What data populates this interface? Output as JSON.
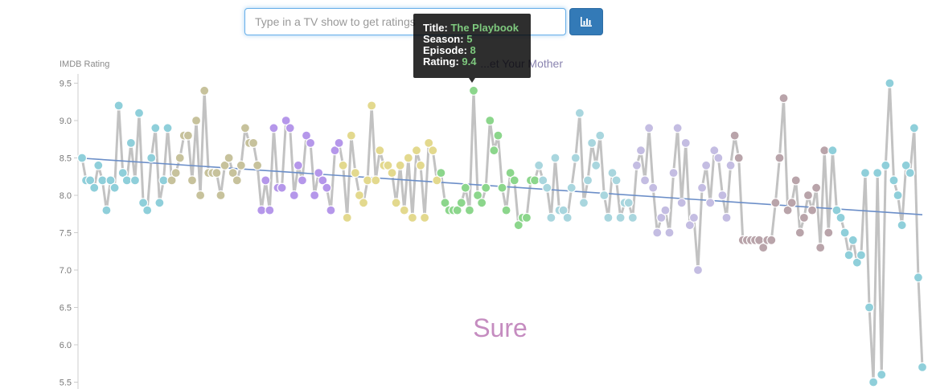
{
  "search": {
    "placeholder": "Type in a TV show to get ratings"
  },
  "tooltip": {
    "title_label": "Title:",
    "title_value": "The Playbook",
    "season_label": "Season:",
    "season_value": "5",
    "episode_label": "Episode:",
    "episode_value": "8",
    "rating_label": "Rating:",
    "rating_value": "9.4"
  },
  "colors": {
    "line": "#c2c2c2",
    "trend": "#6b8ec8",
    "overlay_text": "#c58cc0",
    "season_colors": [
      "#8fcfda",
      "#c7c29c",
      "#b597ea",
      "#e3d98e",
      "#8cd68c",
      "#a9d6de",
      "#c4bde2",
      "#b9a4aa"
    ]
  },
  "chart_data": {
    "type": "scatter",
    "title": "...et Your Mother",
    "ylabel": "IMDB Rating",
    "xlabel": "",
    "overlay_text": "Sure",
    "ylim": [
      5.5,
      9.6
    ],
    "yticks": [
      "5.5",
      "6.0",
      "6.5",
      "7.0",
      "7.5",
      "8.0",
      "8.5",
      "9.0",
      "9.5"
    ],
    "grid": false,
    "trend": {
      "start": 8.5,
      "end": 7.74
    },
    "x": [
      1,
      2,
      3,
      4,
      5,
      6,
      7,
      8,
      9,
      10,
      11,
      12,
      13,
      14,
      15,
      16,
      17,
      18,
      19,
      20,
      21,
      22,
      23,
      24,
      25,
      26,
      27,
      28,
      29,
      30,
      31,
      32,
      33,
      34,
      35,
      36,
      37,
      38,
      39,
      40,
      41,
      42,
      43,
      44,
      45,
      46,
      47,
      48,
      49,
      50,
      51,
      52,
      53,
      54,
      55,
      56,
      57,
      58,
      59,
      60,
      61,
      62,
      63,
      64,
      65,
      66,
      67,
      68,
      69,
      70,
      71,
      72,
      73,
      74,
      75,
      76,
      77,
      78,
      79,
      80,
      81,
      82,
      83,
      84,
      85,
      86,
      87,
      88,
      89,
      90,
      91,
      92,
      93,
      94,
      95,
      96,
      97,
      98,
      99,
      100,
      101,
      102,
      103,
      104,
      105,
      106,
      107,
      108,
      109,
      110,
      111,
      112,
      113,
      114,
      115,
      116,
      117,
      118,
      119,
      120,
      121,
      122,
      123,
      124,
      125,
      126,
      127,
      128,
      129,
      130,
      131,
      132,
      133,
      134,
      135,
      136,
      137,
      138,
      139,
      140,
      141,
      142,
      143,
      144,
      145,
      146,
      147,
      148,
      149,
      150,
      151,
      152,
      153,
      154,
      155,
      156,
      157,
      158,
      159,
      160,
      161,
      162,
      163,
      164,
      165,
      166,
      167,
      168,
      169,
      170,
      171,
      172,
      173,
      174,
      175,
      176,
      177,
      178,
      179,
      180,
      181,
      182,
      183,
      184,
      185,
      186,
      187,
      188,
      189,
      190,
      191,
      192,
      193,
      194,
      195,
      196,
      197,
      198,
      199,
      200,
      201,
      202,
      203,
      204,
      205,
      206,
      207,
      208
    ],
    "season": [
      1,
      1,
      1,
      1,
      1,
      1,
      1,
      1,
      1,
      1,
      1,
      1,
      1,
      1,
      1,
      1,
      1,
      1,
      1,
      1,
      1,
      1,
      2,
      2,
      2,
      2,
      2,
      2,
      2,
      2,
      2,
      2,
      2,
      2,
      2,
      2,
      2,
      2,
      2,
      2,
      2,
      2,
      2,
      2,
      3,
      3,
      3,
      3,
      3,
      3,
      3,
      3,
      3,
      3,
      3,
      3,
      3,
      3,
      3,
      3,
      3,
      3,
      3,
      3,
      4,
      4,
      4,
      4,
      4,
      4,
      4,
      4,
      4,
      4,
      4,
      4,
      4,
      4,
      4,
      4,
      4,
      4,
      4,
      4,
      4,
      4,
      4,
      4,
      5,
      5,
      5,
      5,
      5,
      5,
      5,
      5,
      5,
      5,
      5,
      5,
      5,
      5,
      5,
      5,
      5,
      5,
      5,
      5,
      5,
      5,
      5,
      5,
      6,
      6,
      6,
      6,
      6,
      6,
      6,
      6,
      6,
      6,
      6,
      6,
      6,
      6,
      6,
      6,
      6,
      6,
      6,
      6,
      6,
      6,
      6,
      6,
      7,
      7,
      7,
      7,
      7,
      7,
      7,
      7,
      7,
      7,
      7,
      7,
      7,
      7,
      7,
      7,
      7,
      7,
      7,
      7,
      7,
      7,
      7,
      7,
      8,
      8,
      8,
      8,
      8,
      8,
      8,
      8,
      8,
      8,
      8,
      8,
      8,
      8,
      8,
      8,
      8,
      8,
      8,
      8,
      8,
      8,
      8,
      8,
      9,
      9,
      9,
      9,
      9,
      9,
      9,
      9,
      9,
      9,
      9,
      9,
      9,
      9,
      9,
      9,
      9,
      9,
      9,
      9,
      9,
      9,
      9,
      9
    ],
    "y": [
      8.5,
      8.2,
      8.2,
      8.1,
      8.4,
      8.2,
      7.8,
      8.2,
      8.1,
      9.2,
      8.3,
      8.2,
      8.7,
      8.2,
      9.1,
      7.9,
      7.8,
      8.5,
      8.9,
      7.9,
      8.2,
      8.9,
      8.2,
      8.3,
      8.5,
      8.8,
      8.8,
      8.2,
      9.0,
      8.0,
      9.4,
      8.3,
      8.3,
      8.3,
      8.0,
      8.4,
      8.5,
      8.3,
      8.2,
      8.4,
      8.9,
      8.7,
      8.7,
      8.4,
      7.8,
      8.2,
      7.8,
      8.9,
      8.1,
      8.1,
      9.0,
      8.9,
      8.0,
      8.4,
      8.2,
      8.8,
      8.7,
      8.0,
      8.3,
      8.2,
      8.1,
      7.8,
      8.6,
      8.7,
      8.4,
      7.7,
      8.8,
      8.3,
      8.0,
      7.9,
      8.2,
      9.2,
      8.2,
      8.6,
      8.4,
      8.4,
      8.3,
      7.9,
      8.4,
      7.8,
      8.5,
      7.7,
      8.6,
      8.4,
      7.7,
      8.7,
      8.6,
      8.2,
      8.3,
      7.9,
      7.8,
      7.8,
      7.8,
      7.9,
      8.1,
      7.8,
      9.4,
      8.0,
      7.9,
      8.1,
      9.0,
      8.6,
      8.8,
      8.1,
      7.8,
      8.3,
      8.2,
      7.6,
      7.7,
      7.7,
      8.2,
      8.2,
      8.4,
      8.2,
      8.1,
      7.7,
      8.5,
      7.8,
      7.8,
      7.7,
      8.1,
      8.5,
      9.1,
      7.9,
      8.2,
      8.7,
      8.4,
      8.8,
      8.0,
      7.7,
      8.3,
      8.2,
      7.7,
      7.9,
      7.9,
      7.7,
      8.4,
      8.6,
      8.2,
      8.9,
      8.1,
      7.5,
      7.7,
      7.8,
      7.5,
      8.3,
      8.9,
      7.9,
      8.7,
      7.6,
      7.7,
      7.0,
      8.1,
      8.4,
      7.9,
      8.6,
      8.5,
      8.0,
      7.7,
      8.4,
      8.8,
      8.5,
      7.4,
      7.4,
      7.4,
      7.4,
      7.4,
      7.3,
      7.4,
      7.4,
      7.9,
      8.5,
      9.3,
      7.8,
      7.9,
      8.2,
      7.5,
      7.7,
      8.0,
      7.8,
      8.1,
      7.3,
      8.6,
      7.5,
      8.6,
      7.8,
      7.7,
      7.5,
      7.2,
      7.4,
      7.1,
      7.2,
      8.3,
      6.5,
      5.5,
      8.3,
      5.6,
      8.4,
      9.5,
      8.2,
      8.0,
      7.6,
      8.4,
      8.3,
      8.9,
      6.9,
      5.7
    ]
  }
}
